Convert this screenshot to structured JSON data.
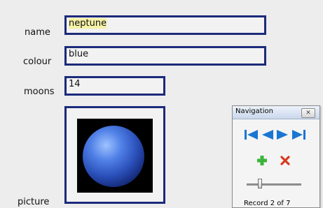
{
  "form": {
    "name_label": "name",
    "name_value": "neptune",
    "colour_label": "colour",
    "colour_value": "blue",
    "moons_label": "moons",
    "moons_value": "14",
    "picture_label": "picture"
  },
  "navigation": {
    "title": "Navigation",
    "close_glyph": "✕",
    "status": "Record 2 of 7",
    "current_record": 2,
    "total_records": 7
  },
  "colors": {
    "field_border": "#1b2a7a",
    "highlight": "#f5f2a6",
    "nav_arrows": "#1976d2",
    "add": "#3cb43c",
    "delete": "#d43c1e"
  },
  "icons": [
    "first-record-icon",
    "previous-record-icon",
    "next-record-icon",
    "last-record-icon",
    "add-record-icon",
    "delete-record-icon",
    "close-icon"
  ]
}
